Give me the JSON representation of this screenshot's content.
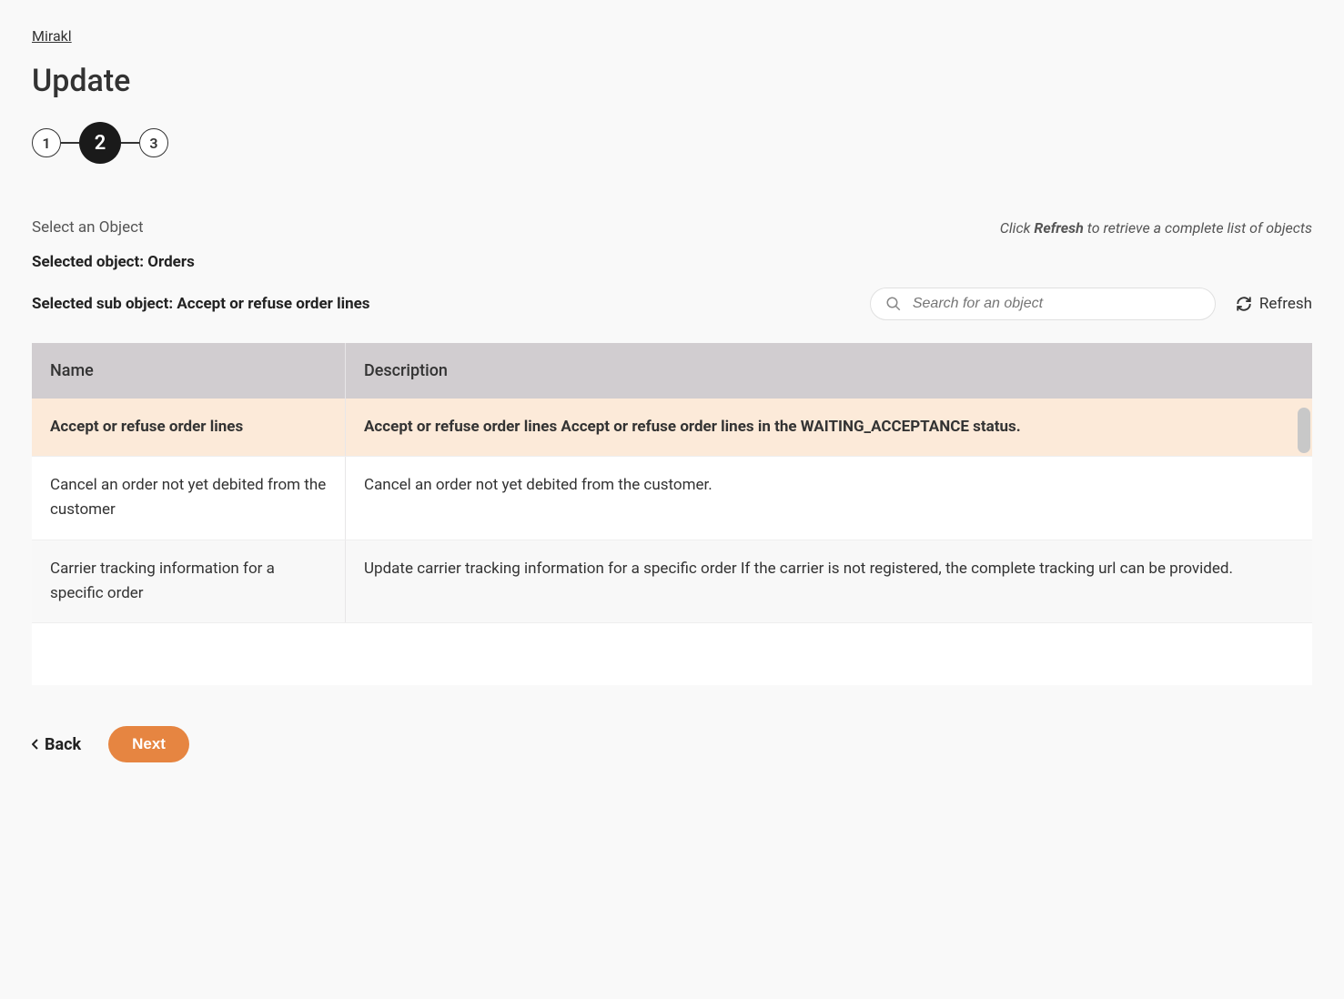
{
  "breadcrumb": "Mirakl",
  "page_title": "Update",
  "stepper": {
    "steps": [
      "1",
      "2",
      "3"
    ],
    "active_index": 1
  },
  "section_label": "Select an Object",
  "refresh_hint_prefix": "Click ",
  "refresh_hint_bold": "Refresh",
  "refresh_hint_suffix": " to retrieve a complete list of objects",
  "selected_object_label": "Selected object: Orders",
  "selected_sub_label": "Selected sub object: Accept or refuse order lines",
  "search_placeholder": "Search for an object",
  "refresh_label": "Refresh",
  "table": {
    "columns": [
      "Name",
      "Description"
    ],
    "rows": [
      {
        "name": "Accept or refuse order lines",
        "description": "Accept or refuse order lines Accept or refuse order lines in the WAITING_ACCEPTANCE status.",
        "selected": true
      },
      {
        "name": "Cancel an order not yet debited from the customer",
        "description": "Cancel an order not yet debited from the customer.",
        "selected": false
      },
      {
        "name": "Carrier tracking information for a specific order",
        "description": "Update carrier tracking information for a specific order If the carrier is not registered, the complete tracking url can be provided.",
        "selected": false
      }
    ]
  },
  "footer": {
    "back_label": "Back",
    "next_label": "Next"
  }
}
